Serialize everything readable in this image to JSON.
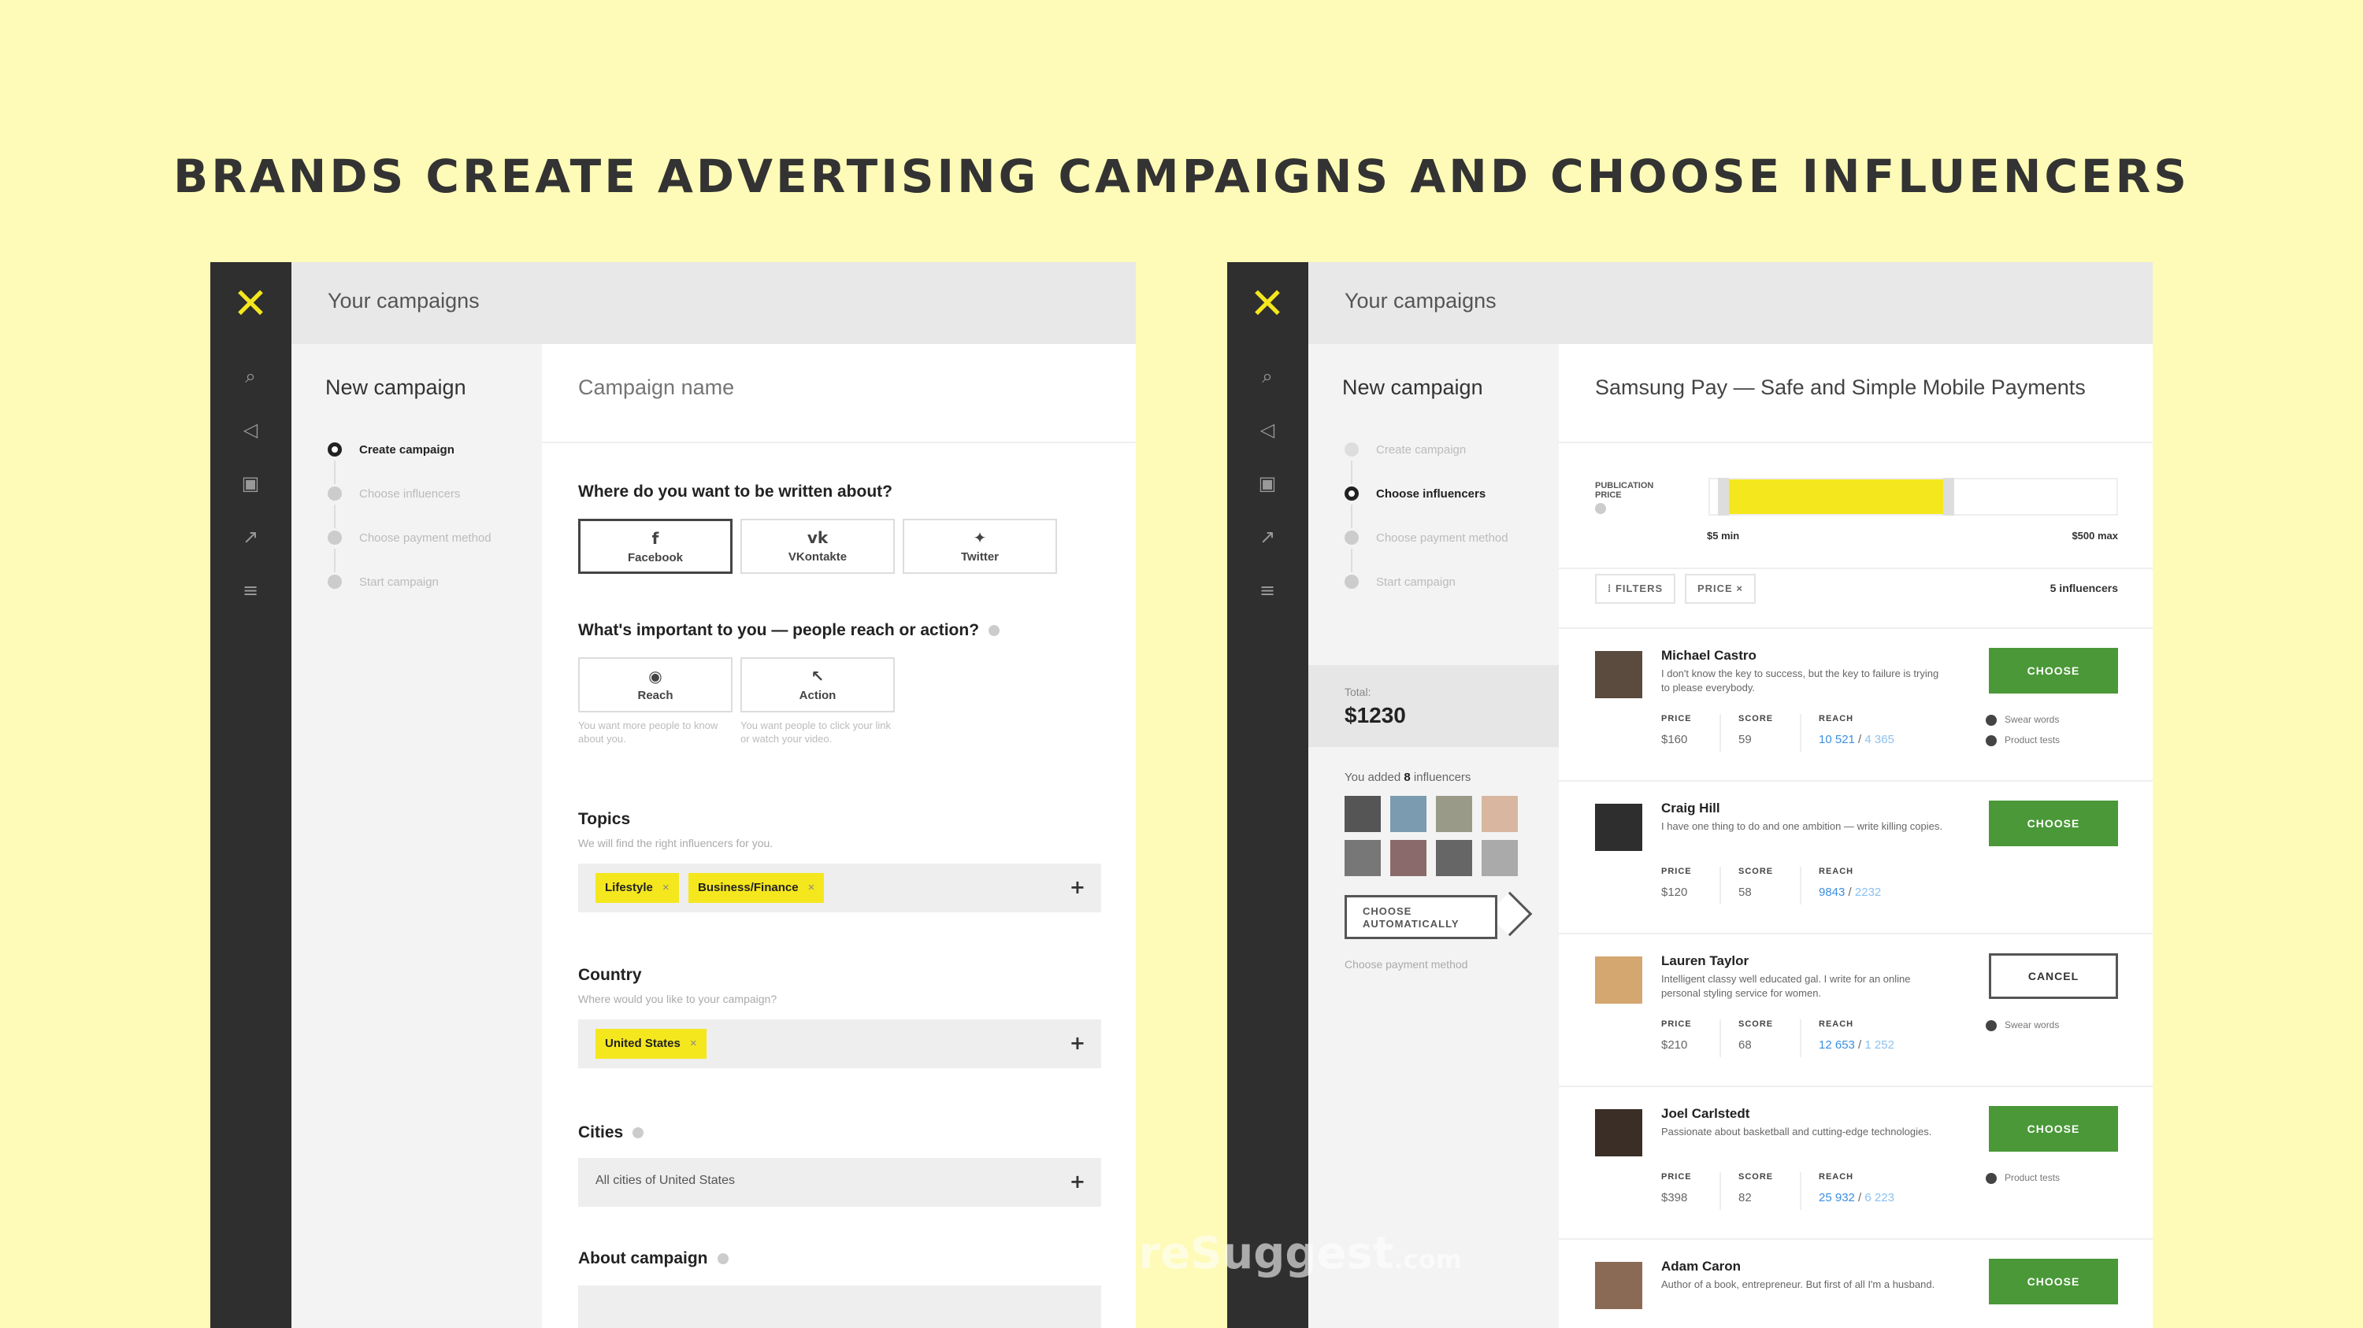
{
  "headline": "BRANDS CREATE ADVERTISING CAMPAIGNS AND CHOOSE INFLUENCERS",
  "left": {
    "topbar_title": "Your campaigns",
    "steps_title": "New campaign",
    "steps": [
      "Create campaign",
      "Choose influencers",
      "Choose payment method",
      "Start campaign"
    ],
    "campaign_name_placeholder": "Campaign name",
    "q_platform": "Where do you want to be written about?",
    "platforms": [
      {
        "icon": "f",
        "label": "Facebook"
      },
      {
        "icon": "vk",
        "label": "VKontakte"
      },
      {
        "icon": "tw",
        "label": "Twitter"
      }
    ],
    "q_goal": "What's important to you — people reach or action?",
    "goals": [
      {
        "icon": "◉",
        "label": "Reach",
        "hint": "You want more people to know about you."
      },
      {
        "icon": "↖",
        "label": "Action",
        "hint": "You want people to click your link or watch your video."
      }
    ],
    "topics_title": "Topics",
    "topics_sub": "We will find the right influencers for you.",
    "topics": [
      "Lifestyle",
      "Business/Finance"
    ],
    "country_title": "Country",
    "country_sub": "Where would you like to your campaign?",
    "countries": [
      "United States"
    ],
    "cities_title": "Cities",
    "cities_value": "All cities of United States",
    "about_title": "About campaign",
    "tag_remove": "×",
    "add_glyph": "+"
  },
  "right": {
    "topbar_title": "Your campaigns",
    "steps_title": "New campaign",
    "steps": [
      "Create campaign",
      "Choose influencers",
      "Choose payment method",
      "Start campaign"
    ],
    "campaign_title": "Samsung Pay — Safe and Simple Mobile Payments",
    "total_label": "Total:",
    "total_value": "$1230",
    "added_prefix": "You added",
    "added_count": "8",
    "added_suffix": "influencers",
    "choose_auto": "CHOOSE AUTOMATICALLY",
    "choose_payment": "Choose payment method",
    "price_label": "PUBLICATION PRICE",
    "price_min": "$5 min",
    "price_max": "$500 max",
    "price_range": [
      0.02,
      0.6
    ],
    "filters_label": "FILTERS",
    "price_chip": "PRICE ×",
    "count_label": "5 influencers",
    "stat_labels": {
      "price": "PRICE",
      "score": "SCORE",
      "reach": "REACH"
    },
    "influencers": [
      {
        "name": "Michael Castro",
        "bio": "I don't know the key to success, but the key to failure is trying to please everybody.",
        "price": "$160",
        "score": "59",
        "reach_a": "10 521",
        "reach_b": "4 365",
        "action": "CHOOSE",
        "features": [
          "Swear words",
          "Product tests"
        ]
      },
      {
        "name": "Craig Hill",
        "bio": "I have one thing to do and one ambition — write killing copies.",
        "price": "$120",
        "score": "58",
        "reach_a": "9843",
        "reach_b": "2232",
        "action": "CHOOSE",
        "features": []
      },
      {
        "name": "Lauren Taylor",
        "bio": "Intelligent classy well educated gal. I write for an online personal styling service for women.",
        "price": "$210",
        "score": "68",
        "reach_a": "12 653",
        "reach_b": "1 252",
        "action": "CANCEL",
        "features": [
          "Swear words"
        ]
      },
      {
        "name": "Joel Carlstedt",
        "bio": "Passionate about basketball and cutting-edge technologies.",
        "price": "$398",
        "score": "82",
        "reach_a": "25 932",
        "reach_b": "6 223",
        "action": "CHOOSE",
        "features": [
          "Product tests"
        ]
      },
      {
        "name": "Adam Caron",
        "bio": "Author of a book, entrepreneur. But first of all I'm a husband.",
        "price": "",
        "score": "",
        "reach_a": "",
        "reach_b": "",
        "action": "CHOOSE",
        "features": []
      }
    ]
  },
  "watermark": "SoftwareSuggest",
  "watermark_suffix": ".com",
  "colors": {
    "accent": "#f5e71e",
    "choose": "#4a9838",
    "rail": "#2f2f2f",
    "background": "#fdfbb7"
  },
  "rail_icons": [
    "search-icon",
    "megaphone-icon",
    "inbox-icon",
    "chart-icon",
    "database-icon"
  ]
}
